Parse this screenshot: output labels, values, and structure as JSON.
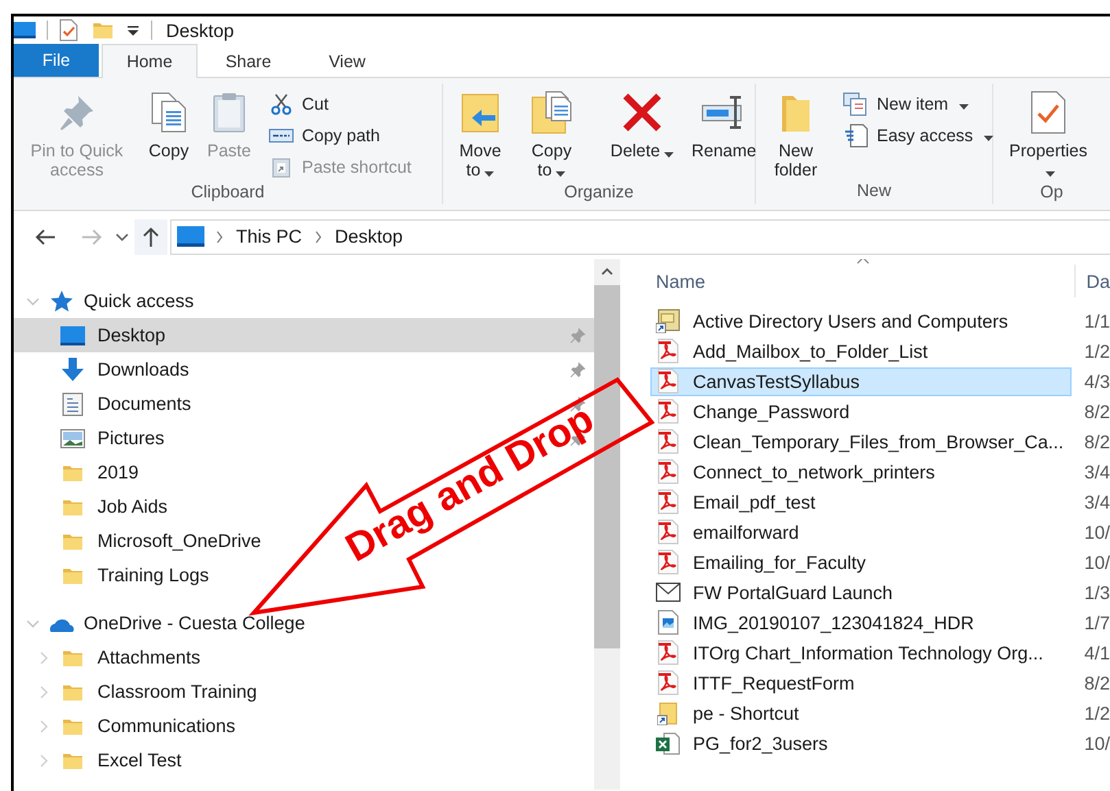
{
  "title_bar": {
    "title": "Desktop"
  },
  "tabs": [
    {
      "label": "File",
      "kind": "file",
      "selected": false
    },
    {
      "label": "Home",
      "kind": "tab",
      "selected": true
    },
    {
      "label": "Share",
      "kind": "tab",
      "selected": false
    },
    {
      "label": "View",
      "kind": "tab",
      "selected": false
    }
  ],
  "ribbon": {
    "groups": [
      {
        "label": "Clipboard",
        "large": [
          {
            "label": "Pin to Quick access",
            "disabled": true,
            "dropdown": false
          },
          {
            "label": "Copy",
            "disabled": false,
            "dropdown": false
          },
          {
            "label": "Paste",
            "disabled": true,
            "dropdown": false
          }
        ],
        "small": [
          {
            "label": "Cut",
            "disabled": false,
            "dropdown": false
          },
          {
            "label": "Copy path",
            "disabled": false,
            "dropdown": false
          },
          {
            "label": "Paste shortcut",
            "disabled": true,
            "dropdown": false
          }
        ]
      },
      {
        "label": "Organize",
        "large": [
          {
            "label": "Move to",
            "disabled": false,
            "dropdown": true
          },
          {
            "label": "Copy to",
            "disabled": false,
            "dropdown": true
          },
          {
            "label": "Delete",
            "disabled": false,
            "dropdown": true
          },
          {
            "label": "Rename",
            "disabled": false,
            "dropdown": false
          }
        ]
      },
      {
        "label": "New",
        "large": [
          {
            "label": "New folder",
            "disabled": false,
            "dropdown": false
          }
        ],
        "small": [
          {
            "label": "New item",
            "disabled": false,
            "dropdown": true
          },
          {
            "label": "Easy access",
            "disabled": false,
            "dropdown": true
          }
        ]
      },
      {
        "label": "Op",
        "large": [
          {
            "label": "Properties",
            "disabled": false,
            "dropdown": true
          }
        ]
      }
    ]
  },
  "address_bar": {
    "back_disabled": false,
    "forward_disabled": true,
    "path": [
      "This PC",
      "Desktop"
    ]
  },
  "navigation": {
    "sections": [
      {
        "label": "Quick access",
        "kind": "quick",
        "expanded": true,
        "items": [
          {
            "label": "Desktop",
            "kind": "desktop",
            "selected": true,
            "pinned": true
          },
          {
            "label": "Downloads",
            "kind": "downloads",
            "selected": false,
            "pinned": true
          },
          {
            "label": "Documents",
            "kind": "documents",
            "selected": false,
            "pinned": true
          },
          {
            "label": "Pictures",
            "kind": "pictures",
            "selected": false,
            "pinned": true
          },
          {
            "label": "2019",
            "kind": "folder",
            "selected": false,
            "pinned": false
          },
          {
            "label": "Job Aids",
            "kind": "folder",
            "selected": false,
            "pinned": false
          },
          {
            "label": "Microsoft_OneDrive",
            "kind": "folder",
            "selected": false,
            "pinned": false
          },
          {
            "label": "Training Logs",
            "kind": "folder",
            "selected": false,
            "pinned": false
          }
        ]
      },
      {
        "label": "OneDrive - Cuesta College",
        "kind": "cloud",
        "expanded": true,
        "items": [
          {
            "label": "Attachments",
            "kind": "folder",
            "selected": false,
            "expanded": false
          },
          {
            "label": "Classroom Training",
            "kind": "folder",
            "selected": false,
            "expanded": false
          },
          {
            "label": "Communications",
            "kind": "folder",
            "selected": false,
            "expanded": false
          },
          {
            "label": "Excel Test",
            "kind": "folder",
            "selected": false,
            "expanded": false
          }
        ]
      }
    ]
  },
  "file_list": {
    "columns": [
      "Name",
      "Da"
    ],
    "rows": [
      {
        "name": "Active Directory Users and Computers",
        "date": "1/1",
        "kind": "app",
        "selected": false
      },
      {
        "name": "Add_Mailbox_to_Folder_List",
        "date": "1/2",
        "kind": "pdf",
        "selected": false
      },
      {
        "name": "CanvasTestSyllabus",
        "date": "4/3",
        "kind": "pdf",
        "selected": true
      },
      {
        "name": "Change_Password",
        "date": "8/2",
        "kind": "pdf",
        "selected": false
      },
      {
        "name": "Clean_Temporary_Files_from_Browser_Ca...",
        "date": "8/2",
        "kind": "pdf",
        "selected": false
      },
      {
        "name": "Connect_to_network_printers",
        "date": "3/4",
        "kind": "pdf",
        "selected": false
      },
      {
        "name": "Email_pdf_test",
        "date": "3/4",
        "kind": "pdf",
        "selected": false
      },
      {
        "name": "emailforward",
        "date": "10/",
        "kind": "pdf",
        "selected": false
      },
      {
        "name": "Emailing_for_Faculty",
        "date": "10/",
        "kind": "pdf",
        "selected": false
      },
      {
        "name": "FW PortalGuard Launch",
        "date": "1/3",
        "kind": "mail",
        "selected": false
      },
      {
        "name": "IMG_20190107_123041824_HDR",
        "date": "1/7",
        "kind": "image",
        "selected": false
      },
      {
        "name": "ITOrg Chart_Information Technology Org...",
        "date": "4/1",
        "kind": "pdf",
        "selected": false
      },
      {
        "name": "ITTF_RequestForm",
        "date": "8/2",
        "kind": "pdf",
        "selected": false
      },
      {
        "name": "pe - Shortcut",
        "date": "1/2",
        "kind": "shortcut",
        "selected": false
      },
      {
        "name": "PG_for2_3users",
        "date": "10/",
        "kind": "excel",
        "selected": false
      }
    ]
  },
  "annotation": {
    "text": "Drag and Drop"
  }
}
